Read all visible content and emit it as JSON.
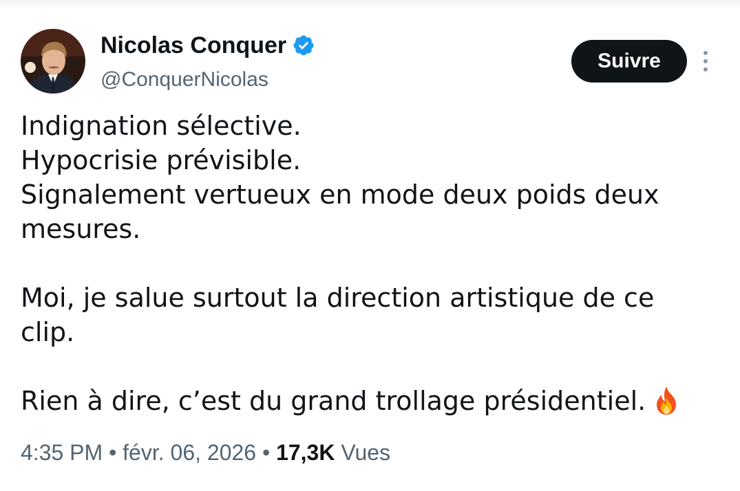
{
  "tweet": {
    "author": {
      "name": "Nicolas Conquer",
      "handle": "@ConquerNicolas",
      "verified": true,
      "avatar": "profile-photo"
    },
    "follow_label": "Suivre",
    "more_icon": "more-vertical-icon",
    "lines": [
      "Indignation sélective.",
      "Hypocrisie prévisible.",
      "Signalement vertueux en mode deux poids deux mesures.",
      "Moi, je salue surtout la direction artistique de ce clip.",
      "Rien à dire, c’est du grand trollage présidentiel."
    ],
    "emoji": "fire-icon",
    "meta": {
      "time": "4:35 PM",
      "separator": "•",
      "date": "févr. 06, 2026",
      "views_count": "17,3K",
      "views_label": "Vues"
    }
  },
  "colors": {
    "text": "#0f1419",
    "secondary": "#536471",
    "verified": "#1d9bf0",
    "button": "#0f1419"
  }
}
